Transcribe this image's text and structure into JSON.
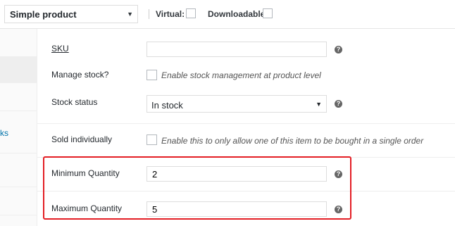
{
  "product_type": {
    "selected": "Simple product"
  },
  "options": {
    "virtual_label": "Virtual:",
    "downloadable_label": "Downloadable:"
  },
  "sidebar": {
    "item_partial_text": "ks"
  },
  "inventory": {
    "sku": {
      "label": "SKU",
      "value": ""
    },
    "manage_stock": {
      "label": "Manage stock?",
      "description": "Enable stock management at product level"
    },
    "stock_status": {
      "label": "Stock status",
      "selected": "In stock"
    },
    "sold_individually": {
      "label": "Sold individually",
      "description": "Enable this to only allow one of this item to be bought in a single order"
    },
    "min_quantity": {
      "label": "Minimum Quantity",
      "value": "2"
    },
    "max_quantity": {
      "label": "Maximum Quantity",
      "value": "5"
    }
  },
  "help_glyph": "?",
  "colors": {
    "highlight": "#e31e24",
    "link": "#0073aa"
  },
  "icons": {
    "help": "help-tip-icon",
    "dropdown": "chevron-down-icon"
  }
}
